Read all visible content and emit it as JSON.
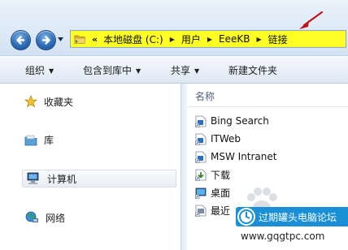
{
  "address_bar": {
    "overflow_chevron": "«",
    "crumbs": [
      "本地磁盘 (C:)",
      "用户",
      "EeeKB",
      "链接"
    ],
    "highlight_color": "#ffff26"
  },
  "toolbar": {
    "organize": "组织",
    "include_in_library": "包含到库中",
    "share": "共享",
    "new_folder": "新建文件夹"
  },
  "nav_pane": {
    "favorites": "收藏夹",
    "libraries": "库",
    "computer": "计算机",
    "network": "网络"
  },
  "content": {
    "column_name": "名称",
    "files": [
      {
        "name": "Bing Search",
        "icon": "link-icon"
      },
      {
        "name": "ITWeb",
        "icon": "link-icon"
      },
      {
        "name": "MSW Intranet",
        "icon": "link-icon"
      },
      {
        "name": "下载",
        "icon": "downloads-shortcut-icon"
      },
      {
        "name": "桌面",
        "icon": "desktop-shortcut-icon"
      },
      {
        "name": "最近",
        "icon": "recent-places-icon"
      }
    ]
  },
  "watermark": {
    "badge_text": "过期罐头电脑论坛",
    "url": "www.gqgtpc.com"
  },
  "annotation": {
    "arrow_color": "#c0141b"
  }
}
